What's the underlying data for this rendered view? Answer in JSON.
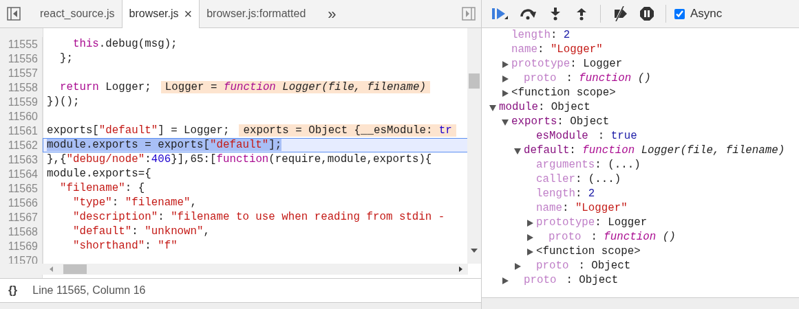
{
  "editor": {
    "tabs": [
      {
        "label": "react_source.js",
        "selected": false
      },
      {
        "label": "browser.js",
        "selected": true,
        "close": "×"
      },
      {
        "label": "browser.js:formatted",
        "selected": false
      }
    ],
    "overflow": "»",
    "lines": [
      {
        "number": "11555",
        "selected": false,
        "tokens": [
          {
            "kind": "kw",
            "text": "    this"
          },
          {
            "kind": "plain",
            "text": ".debug(msg);"
          }
        ]
      },
      {
        "number": "11556",
        "selected": false,
        "tokens": [
          {
            "kind": "plain",
            "text": "  };"
          }
        ]
      },
      {
        "number": "11557",
        "selected": false
      },
      {
        "number": "11558",
        "selected": false,
        "tokens": [
          {
            "kind": "kw",
            "text": "  return"
          },
          {
            "kind": "plain",
            "text": " Logger;"
          }
        ],
        "inline_value": [
          {
            "kind": "plain",
            "text": "Logger = "
          },
          {
            "kind": "fnkw",
            "text": "function"
          },
          {
            "kind": "fn",
            "text": " Logger(file, filename)"
          }
        ]
      },
      {
        "number": "11559",
        "selected": false,
        "tokens": [
          {
            "kind": "plain",
            "text": "})();"
          }
        ]
      },
      {
        "number": "11560",
        "selected": false
      },
      {
        "number": "11561",
        "selected": false,
        "tokens": [
          {
            "kind": "plain",
            "text": "exports["
          },
          {
            "kind": "str",
            "text": "\"default\""
          },
          {
            "kind": "plain",
            "text": "] = Logger;"
          }
        ],
        "inline_value": [
          {
            "kind": "plain",
            "text": "exports = Object {__esModule: "
          },
          {
            "kind": "num",
            "text": "tr"
          }
        ]
      },
      {
        "number": "11562",
        "selected": true,
        "tokens": [
          {
            "kind": "plain",
            "text": "module.exports = exports["
          },
          {
            "kind": "str",
            "text": "\"default\""
          },
          {
            "kind": "plain",
            "text": "];"
          }
        ]
      },
      {
        "number": "11563",
        "selected": false,
        "tokens": [
          {
            "kind": "plain",
            "text": "},{"
          },
          {
            "kind": "str",
            "text": "\"debug/node\""
          },
          {
            "kind": "plain",
            "text": ":"
          },
          {
            "kind": "num",
            "text": "406"
          },
          {
            "kind": "plain",
            "text": "}],65:["
          },
          {
            "kind": "kw",
            "text": "function"
          },
          {
            "kind": "plain",
            "text": "(require,module,exports){"
          }
        ]
      },
      {
        "number": "11564",
        "selected": false,
        "tokens": [
          {
            "kind": "plain",
            "text": "module.exports={"
          }
        ]
      },
      {
        "number": "11565",
        "selected": false,
        "tokens": [
          {
            "kind": "str",
            "text": "  \"filename\""
          },
          {
            "kind": "plain",
            "text": ": {"
          }
        ]
      },
      {
        "number": "11566",
        "selected": false,
        "tokens": [
          {
            "kind": "str",
            "text": "    \"type\""
          },
          {
            "kind": "plain",
            "text": ": "
          },
          {
            "kind": "str",
            "text": "\"filename\""
          },
          {
            "kind": "plain",
            "text": ","
          }
        ]
      },
      {
        "number": "11567",
        "selected": false,
        "tokens": [
          {
            "kind": "str",
            "text": "    \"description\""
          },
          {
            "kind": "plain",
            "text": ": "
          },
          {
            "kind": "str",
            "text": "\"filename to use when reading from stdin -"
          }
        ]
      },
      {
        "number": "11568",
        "selected": false,
        "tokens": [
          {
            "kind": "str",
            "text": "    \"default\""
          },
          {
            "kind": "plain",
            "text": ": "
          },
          {
            "kind": "str",
            "text": "\"unknown\""
          },
          {
            "kind": "plain",
            "text": ","
          }
        ]
      },
      {
        "number": "11569",
        "selected": false,
        "tokens": [
          {
            "kind": "str",
            "text": "    \"shorthand\""
          },
          {
            "kind": "plain",
            "text": ": "
          },
          {
            "kind": "str",
            "text": "\"f\""
          }
        ]
      },
      {
        "number": "11570",
        "selected": false
      }
    ],
    "status": {
      "pretty_print": "{}",
      "position": "Line 11565, Column 16"
    }
  },
  "debugger": {
    "toolbar": [
      {
        "kind": "resume"
      },
      {
        "kind": "step-over"
      },
      {
        "kind": "step-into"
      },
      {
        "kind": "step-out"
      },
      {
        "kind": "separator"
      },
      {
        "kind": "deactivate"
      },
      {
        "kind": "pause-exceptions"
      },
      {
        "kind": "separator"
      }
    ],
    "async": {
      "label": "Async",
      "checked": true
    },
    "scope_tail": [
      {
        "key": "length",
        "dim": true,
        "sep": ":",
        "value": "2",
        "kind": "num"
      },
      {
        "key": "name",
        "dim": true,
        "sep": ":",
        "value": "\"Logger\"",
        "kind": "str"
      },
      {
        "key": "prototype",
        "dim": true,
        "sep": ":",
        "value": "Logger",
        "kind": "obj",
        "expanded": false
      },
      {
        "key": "proto",
        "dim": true,
        "internal": true,
        "sep": ":",
        "prefix": "function",
        "value": "()",
        "kind": "fn",
        "expanded": false
      },
      {
        "label": "<function scope>",
        "expanded": false
      }
    ],
    "scope": [
      {
        "key": "module",
        "dim": false,
        "sep": ":",
        "value": "Object",
        "kind": "obj",
        "expanded": true,
        "children": [
          {
            "key": "exports",
            "dim": false,
            "sep": ":",
            "value": "Object",
            "kind": "obj",
            "expanded": true,
            "children": [
              {
                "key": "esModule",
                "dim": false,
                "internal": true,
                "sep": ":",
                "value": "true",
                "kind": "num"
              },
              {
                "key": "default",
                "dim": false,
                "sep": ":",
                "prefix": "function",
                "value": "Logger(file, filename)",
                "kind": "fn",
                "expanded": true,
                "children": [
                  {
                    "key": "arguments",
                    "dim": true,
                    "sep": ":",
                    "value": "(...)",
                    "kind": "obj"
                  },
                  {
                    "key": "caller",
                    "dim": true,
                    "sep": ":",
                    "value": "(...)",
                    "kind": "obj"
                  },
                  {
                    "key": "length",
                    "dim": true,
                    "sep": ":",
                    "value": "2",
                    "kind": "num"
                  },
                  {
                    "key": "name",
                    "dim": true,
                    "sep": ":",
                    "value": "\"Logger\"",
                    "kind": "str"
                  },
                  {
                    "key": "prototype",
                    "dim": true,
                    "sep": ":",
                    "value": "Logger",
                    "kind": "obj",
                    "expanded": false
                  },
                  {
                    "key": "proto",
                    "dim": true,
                    "internal": true,
                    "sep": ":",
                    "prefix": "function",
                    "value": "()",
                    "kind": "fn",
                    "expanded": false
                  },
                  {
                    "label": "<function scope>",
                    "expanded": false
                  }
                ]
              },
              {
                "key": "proto",
                "dim": true,
                "internal": true,
                "sep": ":",
                "value": "Object",
                "kind": "obj",
                "expanded": false
              }
            ]
          },
          {
            "key": "proto",
            "dim": true,
            "internal": true,
            "sep": ":",
            "value": "Object",
            "kind": "obj",
            "expanded": false
          }
        ]
      }
    ]
  }
}
